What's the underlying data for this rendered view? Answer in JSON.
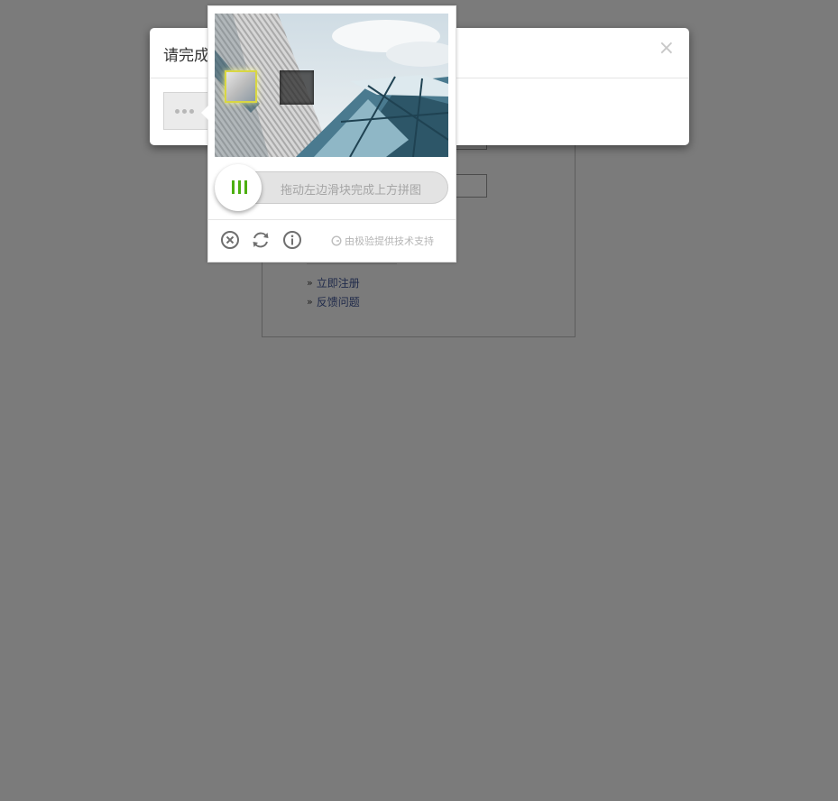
{
  "modal": {
    "title": "请完成",
    "close": "×"
  },
  "captcha": {
    "slider_hint": "拖动左边滑块完成上方拼图",
    "credit": "由极验提供技术支持",
    "icons": [
      "close-circle-icon",
      "refresh-icon",
      "info-icon",
      "geetest-logo-icon"
    ]
  },
  "background": {
    "links": [
      {
        "label": "立即注册"
      },
      {
        "label": "反馈问题"
      }
    ]
  },
  "colors": {
    "overlay": "#7b7b7b",
    "slider_accent": "#4caf10",
    "piece_outline": "#d9d742"
  }
}
